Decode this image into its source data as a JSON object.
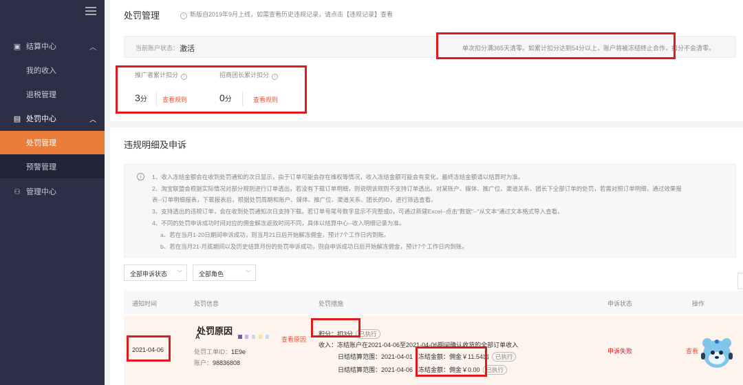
{
  "sidebar": {
    "groups": [
      {
        "label": "结算中心",
        "icon": "wallet-icon",
        "expanded": true
      },
      {
        "label": "处罚中心",
        "icon": "document-icon",
        "expanded": true
      },
      {
        "label": "管理中心",
        "icon": "user-manage-icon",
        "expanded": false
      }
    ],
    "items": [
      {
        "label": "我的收入"
      },
      {
        "label": "退税管理"
      },
      {
        "label": "处罚管理",
        "active": true
      },
      {
        "label": "预警管理"
      }
    ]
  },
  "header": {
    "title": "处罚管理",
    "note": "新版自2019年9月上线，如需查看历史违规记录，请点击【违规记录】查看"
  },
  "account": {
    "status_label": "当前账户状态：",
    "status_value": "激活",
    "rule": "单次扣分满365天清零。如累计扣分达到54分以上，账户将被冻结终止合作，扣分不会清零。"
  },
  "scores": [
    {
      "label": "推广者累计扣分",
      "value": "3",
      "unit": "分",
      "link": "查看规则"
    },
    {
      "label": "招商团长累计扣分",
      "value": "0",
      "unit": "分",
      "link": "查看规则"
    }
  ],
  "section": {
    "title": "违规明细及申诉"
  },
  "notice": {
    "lines": [
      "1、收入冻结金额会在收到处罚通知的次日显示，由于订单可能会存在维权等情况，收入冻结金额可能会有变化，最终冻结金额请以结算时为准。",
      "2、淘宝联盟会根据实际情况对部分规则进行订单透出，若没有下载订单明细，则说明该规则不支持订单透出。对某账户、媒体、推广位、渠道关系、团长下全部订单的处罚，若需对照订单明细，通过效果报",
      "表--订单明细报表，下载报表后，根据处罚周期和账户、媒体、推广位、渠道关系、团长的ID，进行筛选查看。",
      "3、支持透出的违规订单，会在收到处罚通知次日支持下载。若订单号尾号数字显示不完整或0，可通过新建Excel--点击\"数据\"--\"从文本\"通过文本格式导入查看。",
      "4、不同的处罚申诉成功时间对应的佣金解冻返款时间不同，具体以结算中心--收入明细记录为准。",
      "a、若在当月1-20日期间申诉成功，则当月21日后开始解冻佣金，预计7个工作日内到账。",
      "b、若在当月21-月底期间以及历史结算月份的处罚申诉成功，则自申诉成功日后开始解冻佣金，预计7个工作日内到账。"
    ]
  },
  "filters": [
    {
      "value": "全部申诉状态"
    },
    {
      "value": "全部角色"
    }
  ],
  "table": {
    "headers": [
      "通知时间",
      "处罚信息",
      "处罚措施",
      "申诉状态",
      "操作"
    ],
    "row": {
      "date": "2021-04-06",
      "reason_title": "处罚原因",
      "reason_prefix": "A",
      "reason_link": "查看原因",
      "ticket_label": "处罚工单ID：",
      "ticket_value": "1E9e",
      "account_label": "账户：",
      "account_value": "98836808",
      "measure_score": "积分：扣3分",
      "measure_score_tag": "已执行",
      "income_label": "收入：",
      "income_desc": "冻结账户在2021-04-06至2021-04-06期间确认收货的全部订单收入",
      "settle1_label": "日结结算范围：2021-04-01",
      "settle1_amount": "冻结金额：佣金￥11.54",
      "settle1_suffix": "出",
      "settle1_tag": "已执行",
      "settle2_label": "日结结算范围：2021-04-06",
      "settle2_amount": "冻结金额：佣金￥0.00",
      "settle2_tag": "已执行",
      "appeal_status": "申诉失败",
      "action": "查看"
    }
  },
  "colors": {
    "sidebar_bg": "#2e2e46",
    "active_item": "#ec7c3a",
    "highlight_border": "#e0191d",
    "link": "#e8563a",
    "row_bg": "#fdf4ee"
  }
}
